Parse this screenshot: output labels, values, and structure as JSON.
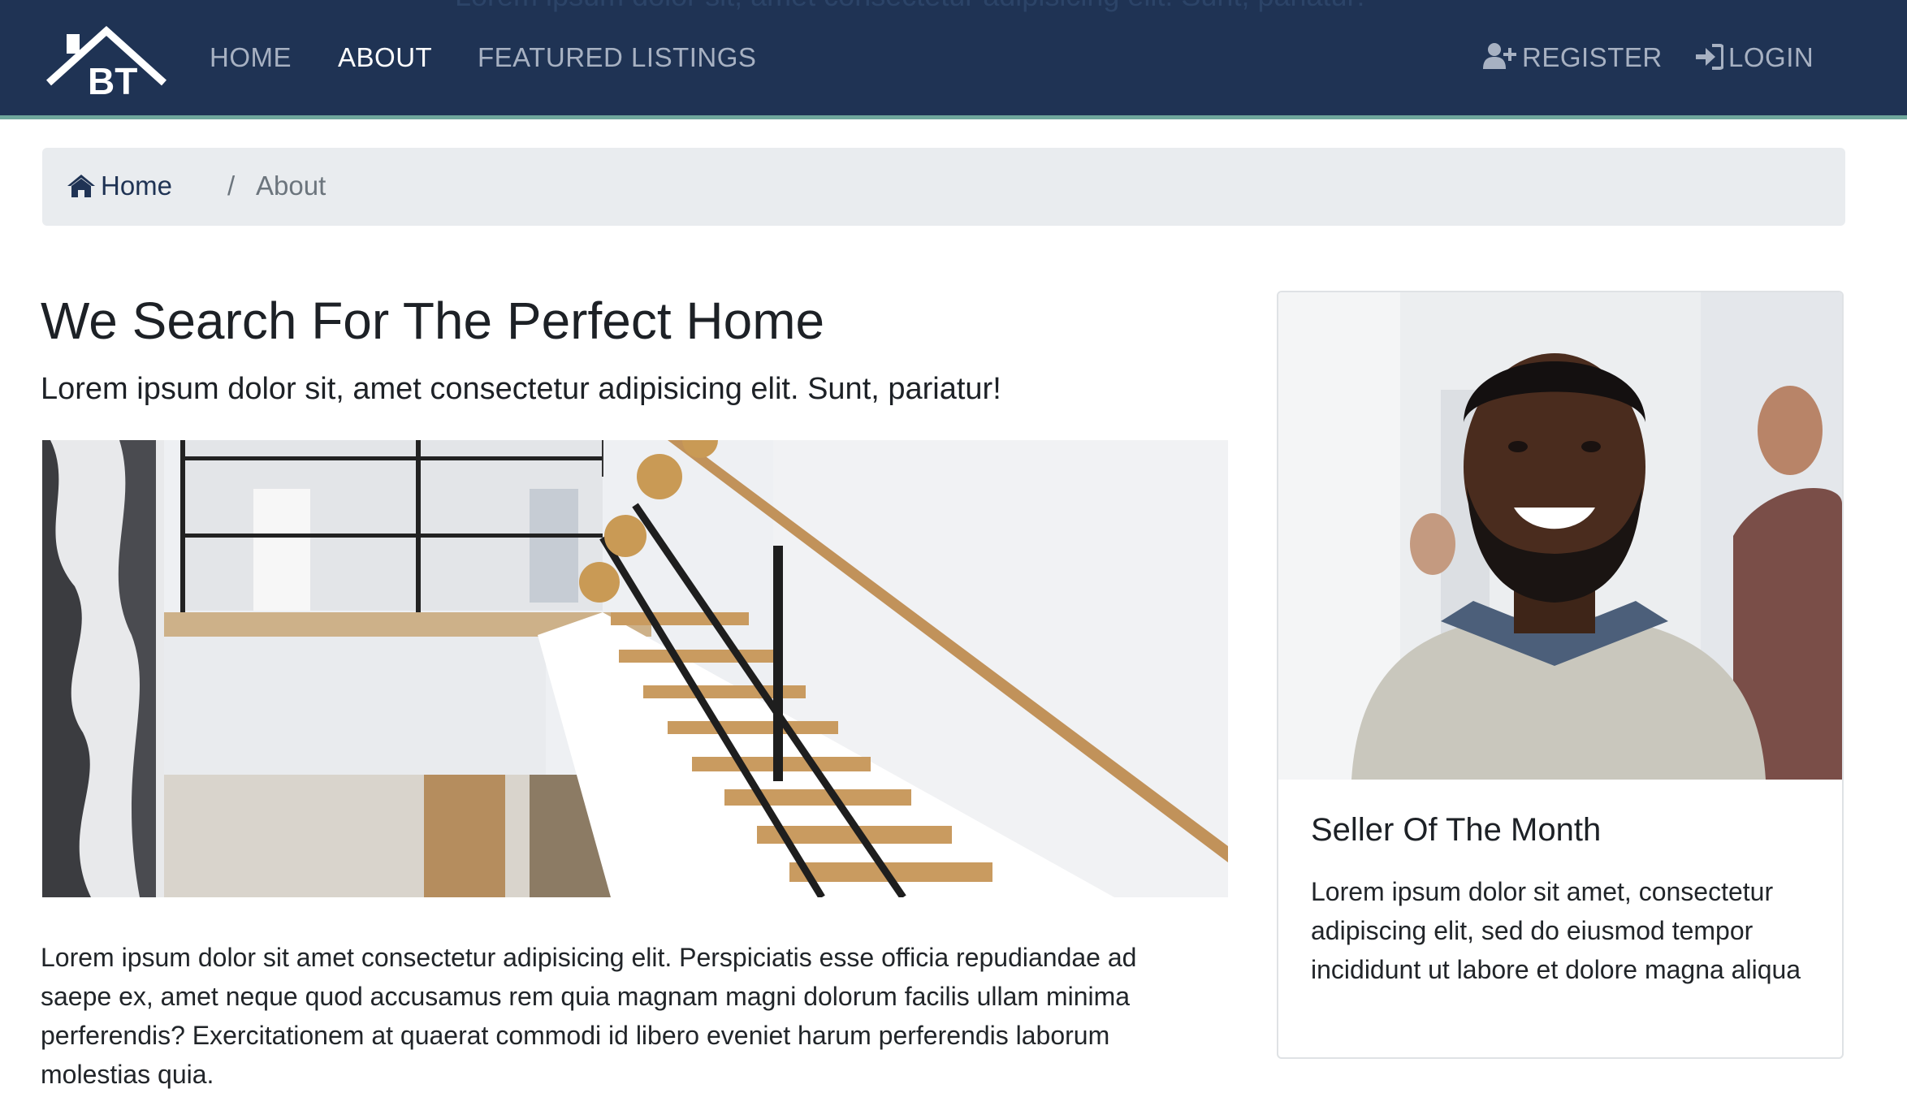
{
  "nav": {
    "logo_text": "BT",
    "ghost_text": "Lorem ipsum dolor sit, amet consectetur adipisicing elit. Sunt, pariatur!",
    "links": [
      {
        "label": "HOME",
        "active": false
      },
      {
        "label": "ABOUT",
        "active": true
      },
      {
        "label": "FEATURED LISTINGS",
        "active": false
      }
    ],
    "register_label": "REGISTER",
    "login_label": "LOGIN",
    "register_icon": "user-plus-icon",
    "login_icon": "sign-in-icon"
  },
  "breadcrumb": {
    "home_label": "Home",
    "home_icon": "home-icon",
    "separator": "/",
    "current": "About"
  },
  "main": {
    "title": "We Search For The Perfect Home",
    "lead": "Lorem ipsum dolor sit, amet consectetur adipisicing elit. Sunt, pariatur!",
    "body": "Lorem ipsum dolor sit amet consectetur adipisicing elit. Perspiciatis esse officia repudiandae ad saepe ex, amet neque quod accusamus rem quia magnam magni dolorum facilis ullam minima perferendis? Exercitationem at quaerat commodi id libero eveniet harum perferendis laborum molestias quia."
  },
  "seller_card": {
    "title": "Seller Of The Month",
    "text": "Lorem ipsum dolor sit amet, consectetur adipiscing elit, sed do eiusmod tempor incididunt ut labore et dolore magna aliqua"
  },
  "colors": {
    "navbar_bg": "#1f3354",
    "navbar_accent": "#6fa79c",
    "nav_link": "#a7b1c2",
    "nav_link_active": "#ffffff",
    "breadcrumb_bg": "#e9ecef"
  }
}
